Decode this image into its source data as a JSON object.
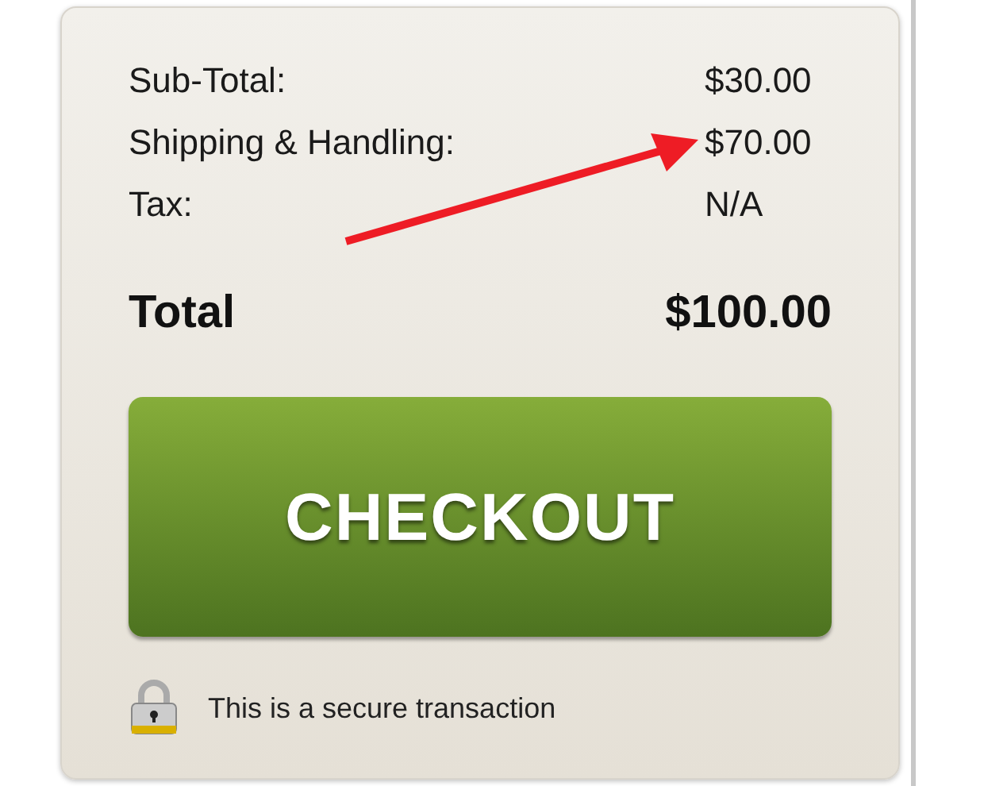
{
  "summary": {
    "rows": [
      {
        "label": "Sub-Total:",
        "value": "$30.00"
      },
      {
        "label": "Shipping & Handling:",
        "value": "$70.00"
      },
      {
        "label": "Tax:",
        "value": "N/A"
      }
    ],
    "total": {
      "label": "Total",
      "value": "$100.00"
    }
  },
  "checkout_button": {
    "label": "CHECKOUT"
  },
  "security_note": "This is a secure transaction"
}
